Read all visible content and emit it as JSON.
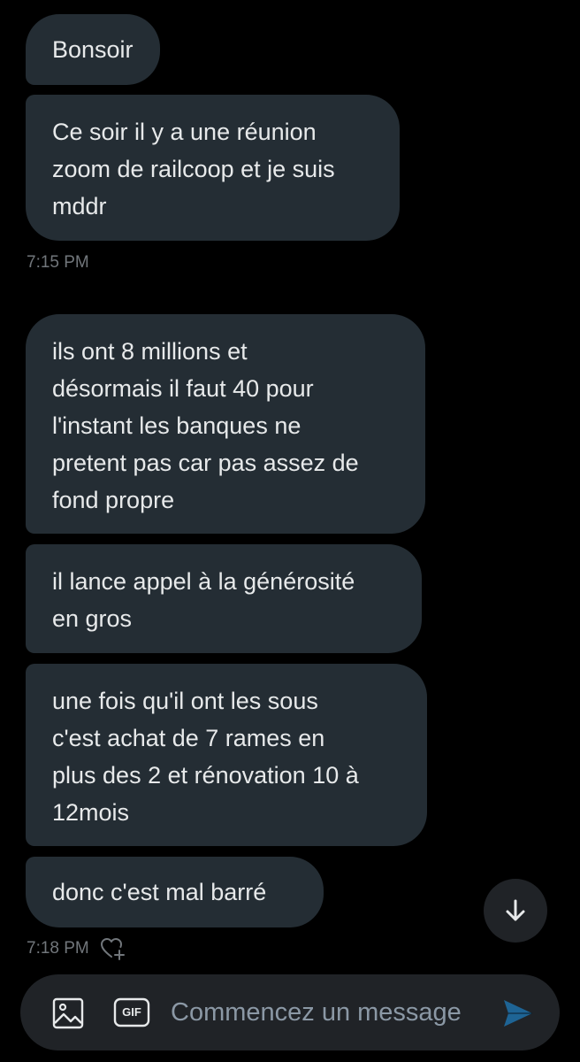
{
  "messages": [
    {
      "text": "Bonsoir"
    },
    {
      "text": "Ce soir il y a une réunion\nzoom de railcoop et je suis\nmddr"
    },
    {
      "text": "ils ont 8 millions et\ndésormais il faut 40 pour\nl'instant les banques ne\npretent pas car pas assez de\nfond propre"
    },
    {
      "text": "il lance appel à la générosité\nen gros"
    },
    {
      "text": "une fois qu'il ont les sous\nc'est achat de 7 rames en\nplus des 2 et rénovation 10 à\n12mois"
    },
    {
      "text": "donc c'est mal barré"
    }
  ],
  "timestamps": {
    "first": "7:15 PM",
    "second": "7:18 PM"
  },
  "composer": {
    "placeholder": "Commencez un message",
    "gif_label": "GIF"
  },
  "icons": {
    "image": "image-icon",
    "gif": "gif-icon",
    "send": "send-icon",
    "scroll": "arrow-down-icon",
    "react": "heart-plus-icon"
  },
  "colors": {
    "background": "#000000",
    "bubble": "#242d34",
    "text": "#e7e9ea",
    "muted": "#71767b",
    "accent": "#1d9bf0"
  }
}
